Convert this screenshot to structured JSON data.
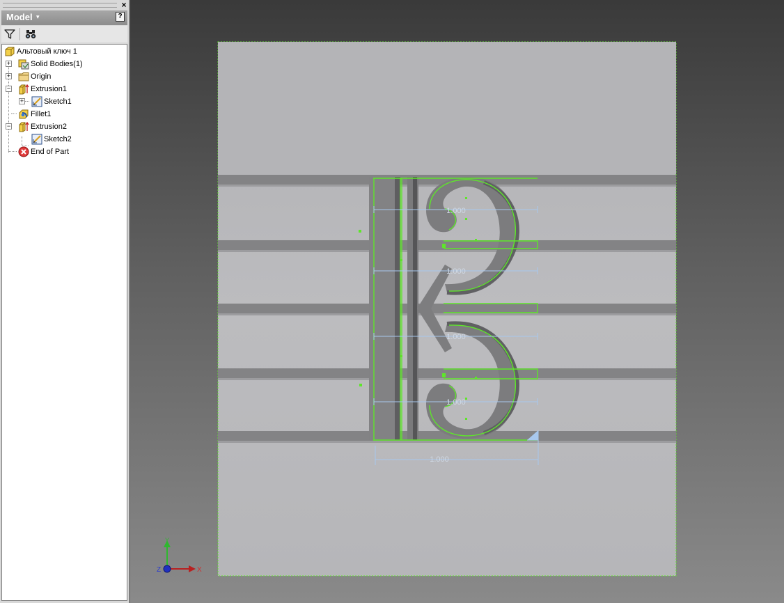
{
  "panel": {
    "title": "Model",
    "title_caret": "▾",
    "close_label": "×",
    "help_label": "?",
    "toolbar": {
      "filter_icon": "filter-icon",
      "find_icon": "binoculars-icon"
    }
  },
  "tree": {
    "root": "Альтовый ключ 1",
    "items": [
      {
        "label": "Solid Bodies(1)",
        "icon": "solid-bodies-icon"
      },
      {
        "label": "Origin",
        "icon": "folder-icon"
      },
      {
        "label": "Extrusion1",
        "icon": "extrusion-icon"
      },
      {
        "label": "Sketch1",
        "icon": "sketch-icon"
      },
      {
        "label": "Fillet1",
        "icon": "fillet-icon"
      },
      {
        "label": "Extrusion2",
        "icon": "extrusion-icon"
      },
      {
        "label": "Sketch2",
        "icon": "sketch-icon"
      },
      {
        "label": "End of Part",
        "icon": "end-of-part-icon"
      }
    ]
  },
  "viewport": {
    "dimensions": [
      "1.000",
      "1.000",
      "1.000",
      "1.000",
      "1.000"
    ],
    "triad": {
      "x": "X",
      "y": "Y",
      "z": "Z"
    },
    "colors": {
      "sketch_line": "#5ee62a",
      "dimension": "#a8c8ee",
      "part": "#b3b3b5",
      "staff": "#838385"
    }
  }
}
